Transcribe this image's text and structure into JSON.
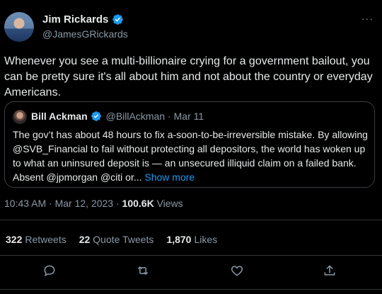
{
  "author": {
    "name": "Jim Rickards",
    "handle": "@JamesGRickards"
  },
  "more_label": "···",
  "tweet_text": "Whenever you see a multi-billionaire crying for a government bailout, you can be pretty sure it's all about him and not about the country or everyday Americans.",
  "quote": {
    "name": "Bill Ackman",
    "handle": "@BillAckman",
    "date": "· Mar 11",
    "text": "The gov’t has about 48 hours to fix a-soon-to-be-irreversible mistake. By allowing @SVB_Financial to fail without protecting all depositors, the world has woken up to what an uninsured deposit is — an unsecured illiquid claim on a failed bank. Absent @jpmorgan @citi or...",
    "show_more": "Show more"
  },
  "meta": {
    "time": "10:43 AM · Mar 12, 2023 · ",
    "views_count": "100.6K",
    "views_label": " Views"
  },
  "stats": {
    "retweets_count": "322",
    "retweets_label": "Retweets",
    "quotes_count": "22",
    "quotes_label": "Quote Tweets",
    "likes_count": "1,870",
    "likes_label": "Likes"
  },
  "icons": {
    "verified": "verified-badge-icon",
    "reply": "reply-icon",
    "retweet": "retweet-icon",
    "like": "heart-icon",
    "share": "share-icon"
  },
  "colors": {
    "background": "#000000",
    "text": "#e7e9ea",
    "secondary": "#8b98a5",
    "accent": "#1d9bf0",
    "border": "#2f3336"
  }
}
